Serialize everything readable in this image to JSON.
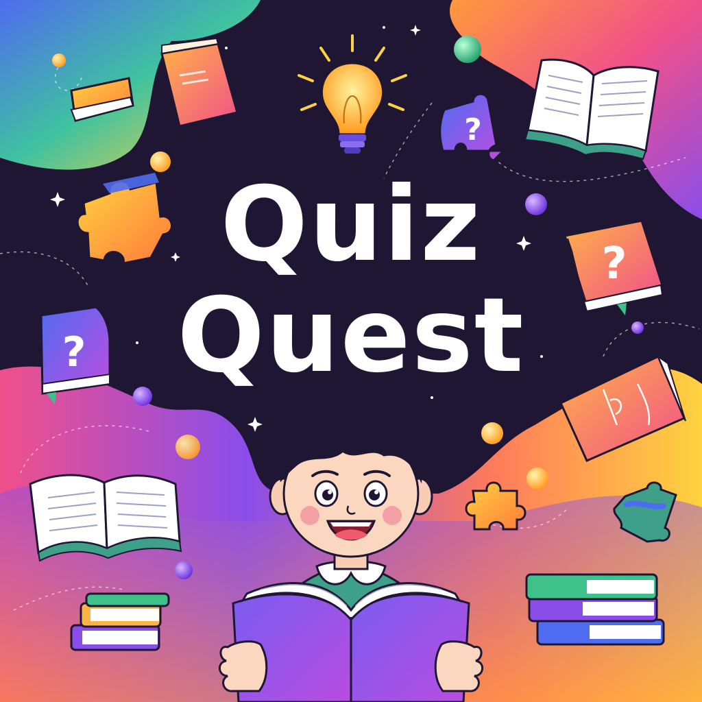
{
  "title": {
    "line1": "Quiz",
    "line2": "Quest"
  },
  "colors": {
    "background": "#1e1633",
    "pink": "#f0508a",
    "orange": "#ff9a3c",
    "yellow": "#ffd23f",
    "purple": "#8a4dea",
    "blue": "#4f6bf0",
    "green": "#3fc28a",
    "teal": "#3fa08a"
  },
  "icons": [
    "book-icon",
    "open-book-icon",
    "lightbulb-icon",
    "puzzle-piece-icon",
    "question-mark-icon",
    "sparkle-icon",
    "orb-icon",
    "book-stack-icon"
  ]
}
